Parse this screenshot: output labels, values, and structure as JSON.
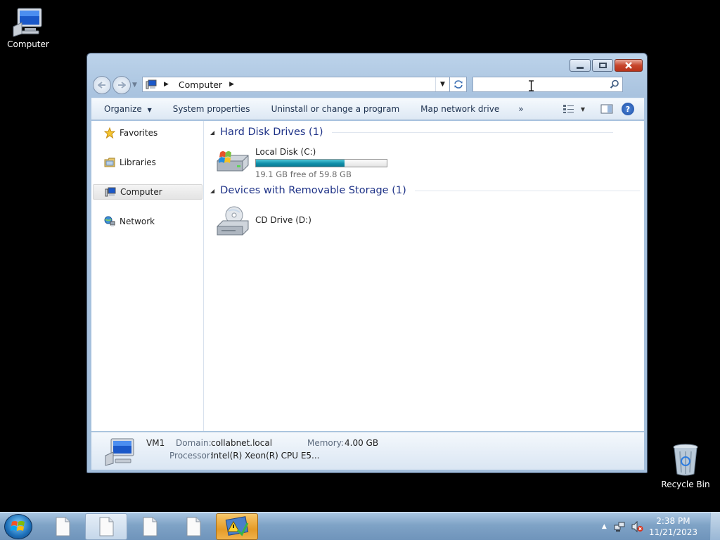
{
  "desktop": {
    "computer_label": "Computer",
    "recycle_label": "Recycle Bin"
  },
  "window": {
    "address": {
      "crumb": "Computer"
    },
    "search": {
      "placeholder": ""
    },
    "toolbar": {
      "organize": "Organize",
      "system_properties": "System properties",
      "uninstall": "Uninstall or change a program",
      "map_drive": "Map network drive",
      "more": "»"
    },
    "navpane": {
      "items": [
        {
          "label": "Favorites"
        },
        {
          "label": "Libraries"
        },
        {
          "label": "Computer"
        },
        {
          "label": "Network"
        }
      ]
    },
    "groups": {
      "hdd": {
        "title": "Hard Disk Drives (1)"
      },
      "removable": {
        "title": "Devices with Removable Storage (1)"
      }
    },
    "drives": {
      "c": {
        "name": "Local Disk (C:)",
        "free": "19.1 GB free of 59.8 GB",
        "used_fraction": 0.68
      },
      "d": {
        "name": "CD Drive (D:)"
      }
    },
    "details": {
      "name": "VM1",
      "domain_label": "Domain:",
      "domain": "collabnet.local",
      "memory_label": "Memory:",
      "memory": "4.00 GB",
      "processor_label": "Processor:",
      "processor": "Intel(R) Xeon(R) CPU E5..."
    }
  },
  "taskbar": {
    "time": "2:38 PM",
    "date": "11/21/2023"
  },
  "colors": {
    "accent": "#1e3287",
    "disk_bar": "#0f8ea8"
  }
}
